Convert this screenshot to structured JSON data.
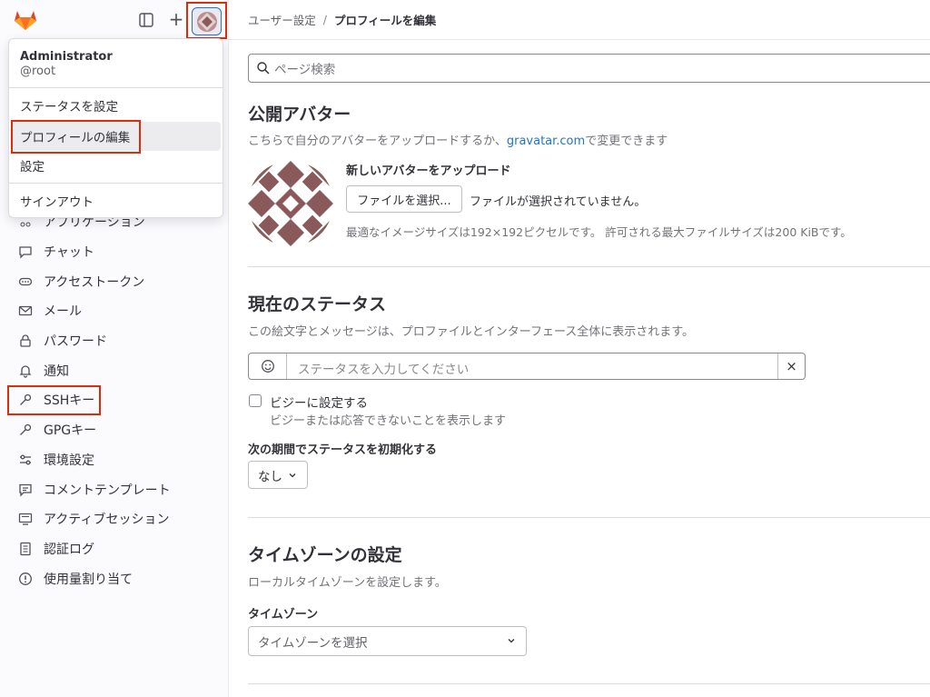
{
  "sidebar": {
    "nav_items": [
      {
        "label": "アプリケーション",
        "icon": "applications-icon"
      },
      {
        "label": "チャット",
        "icon": "chat-icon"
      },
      {
        "label": "アクセストークン",
        "icon": "token-icon"
      },
      {
        "label": "メール",
        "icon": "mail-icon"
      },
      {
        "label": "パスワード",
        "icon": "lock-icon"
      },
      {
        "label": "通知",
        "icon": "bell-icon"
      },
      {
        "label": "SSHキー",
        "icon": "key-icon"
      },
      {
        "label": "GPGキー",
        "icon": "key-icon"
      },
      {
        "label": "環境設定",
        "icon": "preferences-icon"
      },
      {
        "label": "コメントテンプレート",
        "icon": "comment-icon"
      },
      {
        "label": "アクティブセッション",
        "icon": "monitor-icon"
      },
      {
        "label": "認証ログ",
        "icon": "log-icon"
      },
      {
        "label": "使用量割り当て",
        "icon": "quota-icon"
      }
    ]
  },
  "user_menu": {
    "name": "Administrator",
    "username": "@root",
    "items": {
      "set_status": "ステータスを設定",
      "edit_profile": "プロフィールの編集",
      "preferences": "設定",
      "sign_out": "サインアウト"
    }
  },
  "breadcrumb": {
    "parent": "ユーザー設定",
    "separator": "/",
    "current": "プロフィールを編集"
  },
  "search": {
    "placeholder": "ページ検索"
  },
  "avatar_section": {
    "title": "公開アバター",
    "description_prefix": "こちらで自分のアバターをアップロードするか、",
    "link": "gravatar.com",
    "description_suffix": "で変更できます",
    "upload_title": "新しいアバターをアップロード",
    "choose_file": "ファイルを選択...",
    "no_file": "ファイルが選択されていません。",
    "note": "最適なイメージサイズは192×192ピクセルです。 許可される最大ファイルサイズは200 KiBです。"
  },
  "status_section": {
    "title": "現在のステータス",
    "description": "この絵文字とメッセージは、プロファイルとインターフェース全体に表示されます。",
    "placeholder": "ステータスを入力してください",
    "clear": "×",
    "busy_label": "ビジーに設定する",
    "busy_help": "ビジーまたは応答できないことを表示します",
    "clear_after_label": "次の期間でステータスを初期化する",
    "clear_after_value": "なし"
  },
  "timezone_section": {
    "title": "タイムゾーンの設定",
    "description": "ローカルタイムゾーンを設定します。",
    "label": "タイムゾーン",
    "placeholder": "タイムゾーンを選択"
  },
  "colors": {
    "highlight": "#dd2b0e",
    "link": "#1f75cb",
    "avatar": "#8a5a5a"
  }
}
